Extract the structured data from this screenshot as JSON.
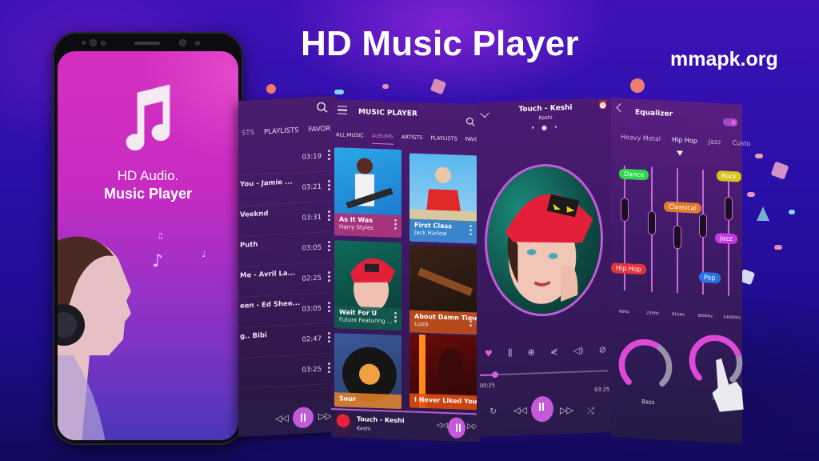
{
  "headline": "HD Music Player",
  "site": "mmapk.org",
  "colors": {
    "accent": "#c45ad9",
    "bg_dark": "#1d0c8a",
    "panel": "#3a1a5a"
  },
  "splash": {
    "icon": "music-note-icon",
    "line1": "HD Audio.",
    "line2": "Music Player"
  },
  "song_list": {
    "tabs": [
      "STS",
      "PLAYLISTS",
      "FAVOR"
    ],
    "rows": [
      {
        "title": "",
        "duration": "03:19"
      },
      {
        "title": "You - Jamie ...",
        "duration": "03:21"
      },
      {
        "title": "Veeknd",
        "duration": "03:31"
      },
      {
        "title": "Puth",
        "duration": "03:05"
      },
      {
        "title": "Me - Avril La...",
        "duration": "02:25"
      },
      {
        "title": "een - Ed Shee...",
        "duration": "03:05"
      },
      {
        "title": "g.. Bibi",
        "duration": "02:47"
      },
      {
        "title": "",
        "duration": "03:25"
      }
    ]
  },
  "albums_screen": {
    "header": "MUSIC PLAYER",
    "tabs": [
      "ALL MUSIC",
      "ALBUMS",
      "ARTISTS",
      "PLAYLISTS",
      "FAVOR"
    ],
    "active_tab": "ALBUMS",
    "albums": [
      {
        "title": "As It Was",
        "artist": "Harry Styles"
      },
      {
        "title": "First Class",
        "artist": "Jack Harlow"
      },
      {
        "title": "Wait For U",
        "artist": "Future Featuring ..."
      },
      {
        "title": "About Damn Time",
        "artist": "Lizzo"
      },
      {
        "title": "Sour",
        "artist": ""
      },
      {
        "title": "I Never Liked You",
        "artist": ""
      }
    ],
    "mini_player": {
      "title": "Touch - Keshi",
      "artist": "Keshi"
    }
  },
  "now_playing": {
    "title": "Touch - Keshi",
    "artist": "Keshi",
    "pager": "• ● •",
    "actions": [
      "heart-icon",
      "equalizer-icon",
      "add-icon",
      "share-icon",
      "volume-icon",
      "no-lyrics-icon"
    ],
    "current_time": "00:25",
    "total_time": "03:25",
    "progress": 0.12
  },
  "equalizer": {
    "title": "Equalizer",
    "enabled": true,
    "presets": [
      "Heavy Metal",
      "Hip Hop",
      "Jazz",
      "Custo"
    ],
    "active_preset": "Hip Hop",
    "bands": [
      {
        "freq": "60Hz",
        "level": 0.65
      },
      {
        "freq": "230Hz",
        "level": 0.55
      },
      {
        "freq": "910Hz",
        "level": 0.45
      },
      {
        "freq": "3600Hz",
        "level": 0.55
      },
      {
        "freq": "14000Hz",
        "level": 0.7
      }
    ],
    "genre_tags": [
      "Dance",
      "Rock",
      "Classical",
      "Jazz",
      "Hip Hop",
      "Pop"
    ],
    "dials": [
      {
        "label": "Bass",
        "value": 0.6
      },
      {
        "label": "3D",
        "value": 0.75
      }
    ]
  }
}
